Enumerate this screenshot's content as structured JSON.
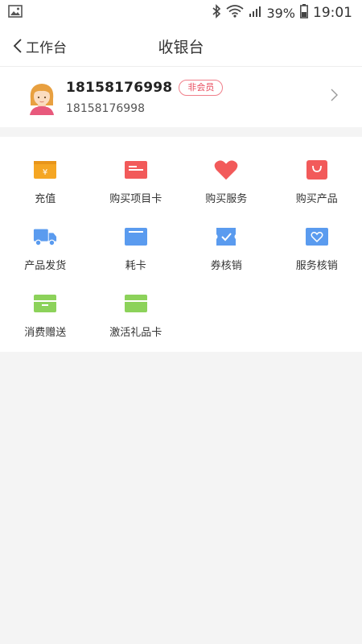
{
  "status_bar": {
    "battery": "39%",
    "time": "19:01"
  },
  "nav": {
    "back_label": "工作台",
    "title": "收银台"
  },
  "member": {
    "name": "18158176998",
    "badge": "非会员",
    "phone": "18158176998"
  },
  "grid": {
    "items": [
      {
        "label": "充值",
        "icon": "recharge-icon",
        "color": "#f5a623"
      },
      {
        "label": "购买项目卡",
        "icon": "project-card-icon",
        "color": "#f25a5a"
      },
      {
        "label": "购买服务",
        "icon": "heart-icon",
        "color": "#f25a5a"
      },
      {
        "label": "购买产品",
        "icon": "shopping-bag-icon",
        "color": "#f25a5a"
      },
      {
        "label": "产品发货",
        "icon": "truck-icon",
        "color": "#5a9bef"
      },
      {
        "label": "耗卡",
        "icon": "card-icon",
        "color": "#5a9bef"
      },
      {
        "label": "券核销",
        "icon": "coupon-check-icon",
        "color": "#5a9bef"
      },
      {
        "label": "服务核销",
        "icon": "service-verify-icon",
        "color": "#5a9bef"
      },
      {
        "label": "消费赠送",
        "icon": "gift-card-icon",
        "color": "#8cd25a"
      },
      {
        "label": "激活礼品卡",
        "icon": "activate-card-icon",
        "color": "#8cd25a"
      }
    ]
  }
}
